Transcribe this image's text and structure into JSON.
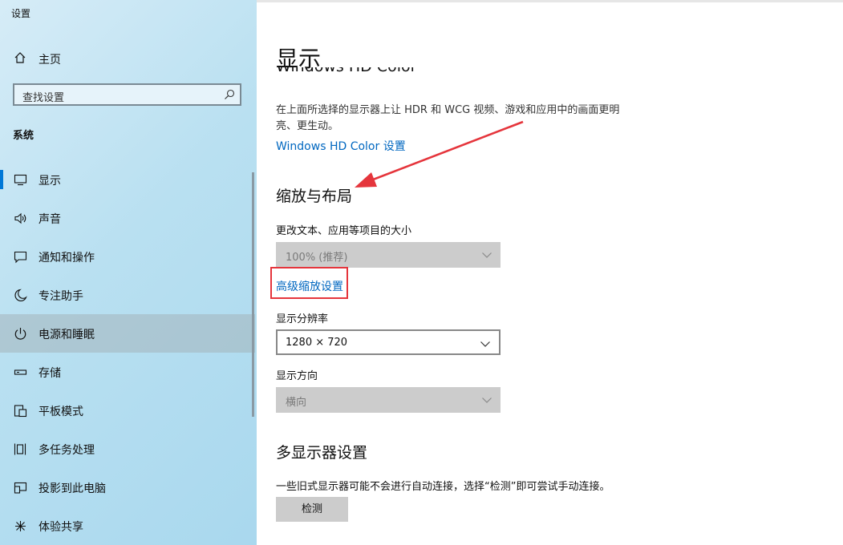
{
  "window": {
    "title": "设置"
  },
  "sidebar": {
    "home_label": "主页",
    "search_placeholder": "查找设置",
    "section_title": "系统",
    "items": [
      {
        "label": "显示",
        "icon": "monitor-icon",
        "active": true
      },
      {
        "label": "声音",
        "icon": "speaker-icon"
      },
      {
        "label": "通知和操作",
        "icon": "notification-icon"
      },
      {
        "label": "专注助手",
        "icon": "moon-icon"
      },
      {
        "label": "电源和睡眠",
        "icon": "power-icon",
        "hover": true
      },
      {
        "label": "存储",
        "icon": "storage-icon"
      },
      {
        "label": "平板模式",
        "icon": "tablet-icon"
      },
      {
        "label": "多任务处理",
        "icon": "multitask-icon"
      },
      {
        "label": "投影到此电脑",
        "icon": "project-icon"
      },
      {
        "label": "体验共享",
        "icon": "share-icon"
      }
    ]
  },
  "content": {
    "page_title": "显示",
    "hdr_heading": "Windows HD Color",
    "hdr_desc": "在上面所选择的显示器上让 HDR 和 WCG 视频、游戏和应用中的画面更明亮、更生动。",
    "hdr_link": "Windows HD Color 设置",
    "scale_heading": "缩放与布局",
    "scale_label": "更改文本、应用等项目的大小",
    "scale_value": "100% (推荐)",
    "advanced_scale_link": "高级缩放设置",
    "resolution_label": "显示分辨率",
    "resolution_value": "1280 × 720",
    "orientation_label": "显示方向",
    "orientation_value": "横向",
    "multi_heading": "多显示器设置",
    "multi_desc": "一些旧式显示器可能不会进行自动连接，选择“检测”即可尝试手动连接。",
    "detect_button": "检测"
  },
  "annotations": {
    "arrow_color": "#e5353c",
    "box_color": "#e5353c"
  }
}
